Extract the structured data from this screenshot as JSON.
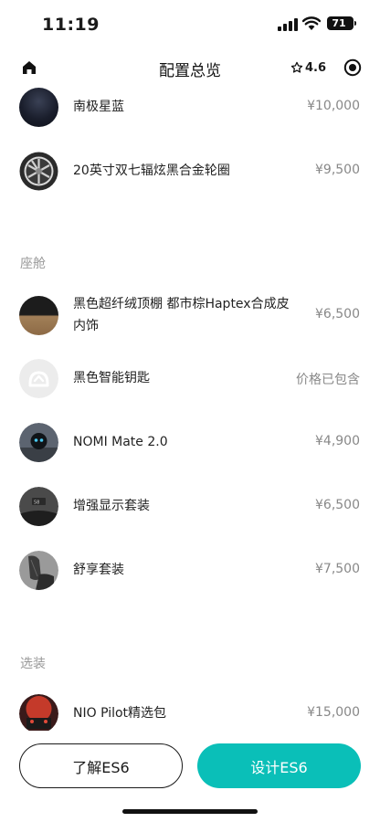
{
  "status": {
    "time": "11:19",
    "battery": "71"
  },
  "nav": {
    "title": "配置总览",
    "rating": "4.6"
  },
  "rows_top": [
    {
      "label": "南极星蓝",
      "price": "¥10,000",
      "icon": "paint-swatch-icon"
    },
    {
      "label": "20英寸双七辐炫黑合金轮圈",
      "price": "¥9,500",
      "icon": "wheel-icon"
    }
  ],
  "sections": {
    "cabin": "座舱",
    "options": "选装"
  },
  "rows_cabin": [
    {
      "label_line1": "黑色超纤绒顶棚 都市棕Haptex合成皮",
      "label_line2": "内饰",
      "price": "¥6,500",
      "icon": "interior-swatch-icon"
    },
    {
      "label": "黑色智能钥匙",
      "price": "价格已包含",
      "icon": "smart-key-icon"
    },
    {
      "label": "NOMI Mate 2.0",
      "price": "¥4,900",
      "icon": "nomi-icon"
    },
    {
      "label": "增强显示套装",
      "price": "¥6,500",
      "icon": "display-icon"
    },
    {
      "label": "舒享套装",
      "price": "¥7,500",
      "icon": "seat-icon"
    }
  ],
  "rows_options": [
    {
      "label": "NIO Pilot精选包",
      "price": "¥15,000",
      "icon": "pilot-icon"
    }
  ],
  "footer": {
    "learn_label": "了解ES6",
    "design_label": "设计ES6"
  },
  "colors": {
    "accent": "#0abfb8",
    "price": "#888888",
    "section": "#999999"
  }
}
